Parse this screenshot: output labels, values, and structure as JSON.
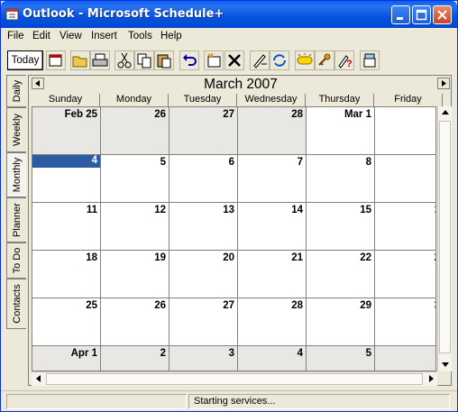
{
  "window": {
    "title": "Outlook - Microsoft Schedule+"
  },
  "menu": [
    "File",
    "Edit",
    "View",
    "Insert",
    "Tools",
    "Help"
  ],
  "toolbar": {
    "today_label": "Today",
    "icons": [
      "date-picker-icon",
      "open-icon",
      "print-icon",
      "cut-icon",
      "copy-icon",
      "paste-icon",
      "undo-icon",
      "new-appointment-icon",
      "delete-icon",
      "edit-icon",
      "recurring-icon",
      "reminder-icon",
      "private-icon",
      "tentative-icon",
      "meeting-wizard-icon"
    ]
  },
  "tabs": [
    "Daily",
    "Weekly",
    "Monthly",
    "Planner",
    "To Do",
    "Contacts"
  ],
  "calendar": {
    "month_title": "March 2007",
    "weekdays": [
      "Sunday",
      "Monday",
      "Tuesday",
      "Wednesday",
      "Thursday",
      "Friday"
    ],
    "weeks": [
      [
        {
          "d": "Feb 25",
          "o": true
        },
        {
          "d": "26",
          "o": true
        },
        {
          "d": "27",
          "o": true
        },
        {
          "d": "28",
          "o": true
        },
        {
          "d": "Mar 1",
          "o": false
        },
        {
          "d": "",
          "o": false
        }
      ],
      [
        {
          "d": "4",
          "o": false,
          "sel": true
        },
        {
          "d": "5",
          "o": false
        },
        {
          "d": "6",
          "o": false
        },
        {
          "d": "7",
          "o": false
        },
        {
          "d": "8",
          "o": false
        },
        {
          "d": "",
          "o": false
        }
      ],
      [
        {
          "d": "11",
          "o": false
        },
        {
          "d": "12",
          "o": false
        },
        {
          "d": "13",
          "o": false
        },
        {
          "d": "14",
          "o": false
        },
        {
          "d": "15",
          "o": false
        },
        {
          "d": "1",
          "o": false
        }
      ],
      [
        {
          "d": "18",
          "o": false
        },
        {
          "d": "19",
          "o": false
        },
        {
          "d": "20",
          "o": false
        },
        {
          "d": "21",
          "o": false
        },
        {
          "d": "22",
          "o": false
        },
        {
          "d": "2",
          "o": false
        }
      ],
      [
        {
          "d": "25",
          "o": false
        },
        {
          "d": "26",
          "o": false
        },
        {
          "d": "27",
          "o": false
        },
        {
          "d": "28",
          "o": false
        },
        {
          "d": "29",
          "o": false
        },
        {
          "d": "3",
          "o": false
        }
      ],
      [
        {
          "d": "Apr 1",
          "o": true
        },
        {
          "d": "2",
          "o": true
        },
        {
          "d": "3",
          "o": true
        },
        {
          "d": "4",
          "o": true
        },
        {
          "d": "5",
          "o": true
        },
        {
          "d": "",
          "o": true
        }
      ]
    ]
  },
  "status": {
    "message": "Starting services..."
  },
  "colors": {
    "titlebar": "#0a5ef4",
    "selected_day": "#2c5ca4",
    "other_month": "#e9e7e4"
  }
}
